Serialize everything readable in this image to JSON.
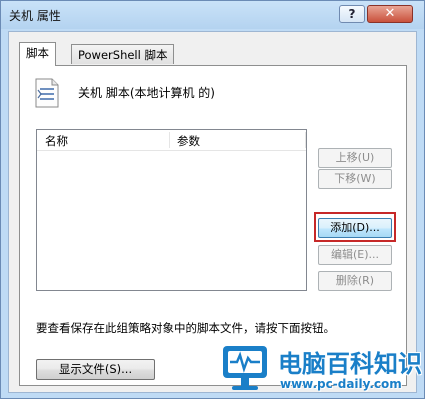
{
  "window": {
    "title": "关机 属性",
    "help_label": "?",
    "close_label": "✕"
  },
  "tabs": [
    {
      "label": "脚本"
    },
    {
      "label": "PowerShell 脚本"
    }
  ],
  "script_panel": {
    "heading": "关机 脚本(本地计算机 的)",
    "icon": "script-document-icon",
    "columns": [
      "名称",
      "参数"
    ],
    "rows": []
  },
  "buttons": {
    "up": "上移(U)",
    "down": "下移(W)",
    "add": "添加(D)...",
    "edit": "编辑(E)...",
    "delete": "删除(R)",
    "show_files": "显示文件(S)..."
  },
  "hint_text": "要查看保存在此组策略对象中的脚本文件，请按下面按钮。",
  "highlight_color": "#c62828",
  "watermark": {
    "title": "电脑百科知识",
    "url": "www.pc-daily.com",
    "icon": "monitor-pulse-logo"
  }
}
